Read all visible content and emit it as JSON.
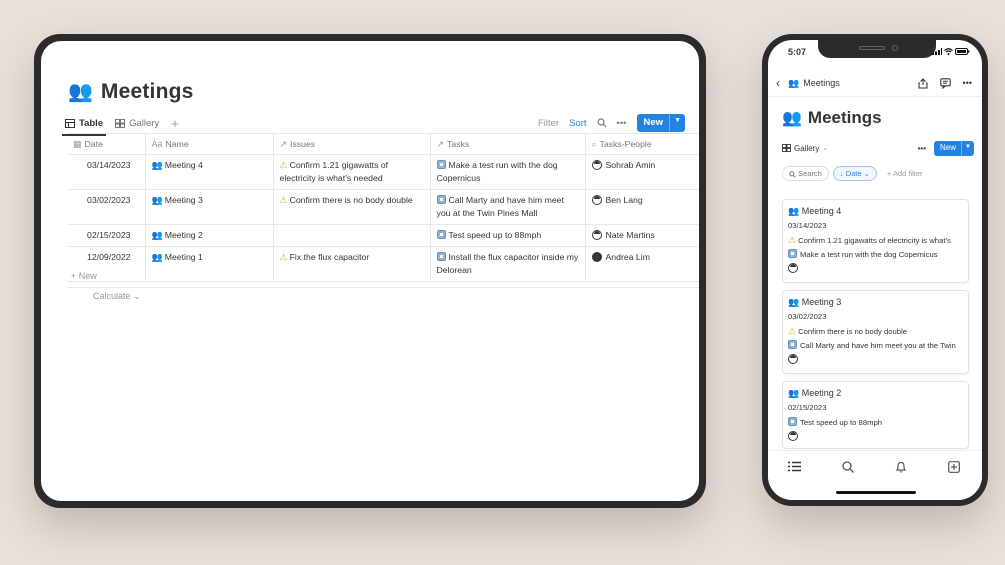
{
  "tablet": {
    "title_emoji": "👥",
    "title": "Meetings",
    "tabs": [
      {
        "label": "Table",
        "active": true
      },
      {
        "label": "Gallery",
        "active": false
      }
    ],
    "toolbar": {
      "filter": "Filter",
      "sort": "Sort",
      "new": "New"
    },
    "columns": [
      "Date",
      "Name",
      "Issues",
      "Tasks",
      "Tasks-People"
    ],
    "rows": [
      {
        "date": "03/14/2023",
        "name": "Meeting 4",
        "issue": "Confirm 1.21 gigawatts  of electricity is what’s needed",
        "task": "Make a test run with the dog Copernicus",
        "person": "Sohrab Amin"
      },
      {
        "date": "03/02/2023",
        "name": "Meeting 3",
        "issue": "Confirm there is no body double",
        "task": "Call Marty and have him meet you at the Twin Pines Mall",
        "person": "Ben Lang"
      },
      {
        "date": "02/15/2023",
        "name": "Meeting 2",
        "issue": "",
        "task": "Test speed up to 88mph",
        "person": "Nate Martins"
      },
      {
        "date": "12/09/2022",
        "name": "Meeting 1",
        "issue": "Fix the flux capacitor",
        "task": "Install the flux capacitor inside my Delorean",
        "person": "Andrea Lim"
      }
    ],
    "new_row": "+ New",
    "calculate": "Calculate ⌄"
  },
  "phone": {
    "time": "5:07",
    "nav_title": "Meetings",
    "title_emoji": "👥",
    "title": "Meetings",
    "view": "Gallery",
    "new": "New",
    "search": "Search",
    "date_chip": "↓ Date ⌄",
    "add_filter": "+ Add filter",
    "cards": [
      {
        "title": "Meeting 4",
        "date": "03/14/2023",
        "issue": "Confirm 1.21 gigawatts  of electricity is what’s",
        "task": "Make a test run with the dog Copernicus"
      },
      {
        "title": "Meeting 3",
        "date": "03/02/2023",
        "issue": "Confirm there is no body double",
        "task": "Call Marty and have him meet you at the Twin"
      },
      {
        "title": "Meeting 2",
        "date": "02/15/2023",
        "issue": "",
        "task": "Test speed up to 88mph"
      }
    ]
  },
  "colors": {
    "accent": "#2383e2",
    "frame": "#2b2b2b",
    "background": "#e8e0db"
  }
}
